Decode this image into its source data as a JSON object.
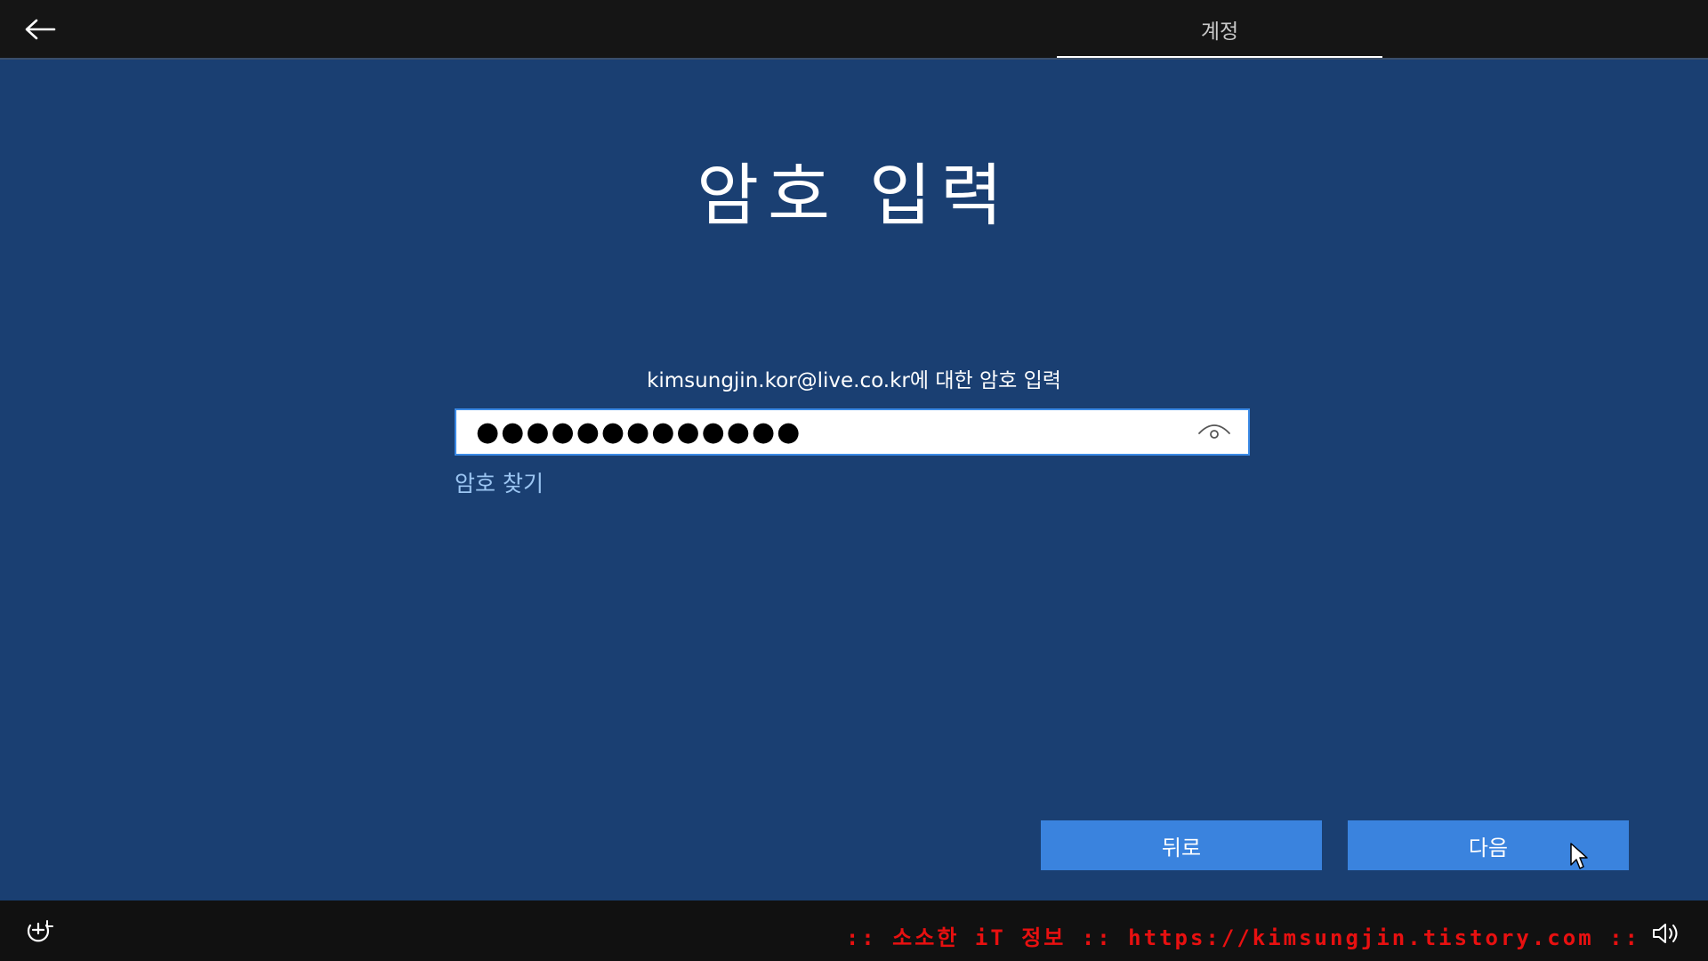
{
  "header": {
    "back_icon": "arrow-left-icon",
    "tab_label": "계정"
  },
  "main": {
    "title": "암호 입력",
    "prompt": "kimsungjin.kor@live.co.kr에 대한 암호 입력",
    "password_masked": "●●●●●●●●●●●●●",
    "reveal_icon": "eye-icon",
    "forgot_link": "암호 찾기"
  },
  "buttons": {
    "back_label": "뒤로",
    "next_label": "다음"
  },
  "footer": {
    "accessibility_icon": "ease-of-access-icon",
    "watermark": ":: 소소한 iT 정보 :: https://kimsungjin.tistory.com ::",
    "volume_icon": "volume-icon"
  },
  "colors": {
    "background": "#1a3f72",
    "button": "#3a83de",
    "link": "#9cc6f3",
    "watermark": "#e81010"
  }
}
